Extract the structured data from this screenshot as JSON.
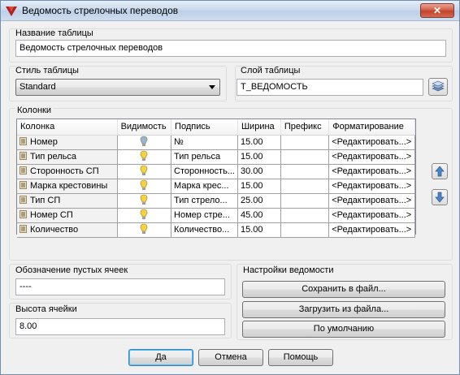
{
  "window": {
    "title": "Ведомость стрелочных переводов"
  },
  "table_name": {
    "label": "Название таблицы",
    "value": "Ведомость стрелочных переводов"
  },
  "table_style": {
    "label": "Стиль таблицы",
    "selected": "Standard"
  },
  "table_layer": {
    "label": "Слой таблицы",
    "value": "Т_ВЕДОМОСТЬ"
  },
  "columns": {
    "group_label": "Колонки",
    "headers": [
      "Колонка",
      "Видимость",
      "Подпись",
      "Ширина",
      "Префикс",
      "Форматирование"
    ],
    "rows": [
      {
        "name": "Номер",
        "visible": false,
        "caption": "№",
        "width": "15.00",
        "prefix": "",
        "format": "<Редактировать...>"
      },
      {
        "name": "Тип рельса",
        "visible": true,
        "caption": "Тип рельса",
        "width": "15.00",
        "prefix": "",
        "format": "<Редактировать...>"
      },
      {
        "name": "Сторонность СП",
        "visible": true,
        "caption": "Сторонность...",
        "width": "30.00",
        "prefix": "",
        "format": "<Редактировать...>"
      },
      {
        "name": "Марка крестовины",
        "visible": true,
        "caption": "Марка крес...",
        "width": "15.00",
        "prefix": "",
        "format": "<Редактировать...>"
      },
      {
        "name": "Тип СП",
        "visible": true,
        "caption": "Тип стрело...",
        "width": "25.00",
        "prefix": "",
        "format": "<Редактировать...>"
      },
      {
        "name": "Номер СП",
        "visible": true,
        "caption": "Номер стре...",
        "width": "45.00",
        "prefix": "",
        "format": "<Редактировать...>"
      },
      {
        "name": "Количество",
        "visible": true,
        "caption": "Количество...",
        "width": "15.00",
        "prefix": "",
        "format": "<Редактировать...>"
      }
    ]
  },
  "empty_cells": {
    "label": "Обозначение пустых ячеек",
    "value": "----"
  },
  "cell_height": {
    "label": "Высота ячейки",
    "value": "8.00"
  },
  "settings": {
    "label": "Настройки ведомости",
    "save_label": "Сохранить в файл...",
    "load_label": "Загрузить из файла...",
    "default_label": "По умолчанию"
  },
  "footer": {
    "ok_label": "Да",
    "cancel_label": "Отмена",
    "help_label": "Помощь"
  },
  "colors": {
    "accent": "#3c7fb1",
    "visible_bulb": "#f7d23e",
    "hidden_bulb": "#8fb7d9"
  }
}
